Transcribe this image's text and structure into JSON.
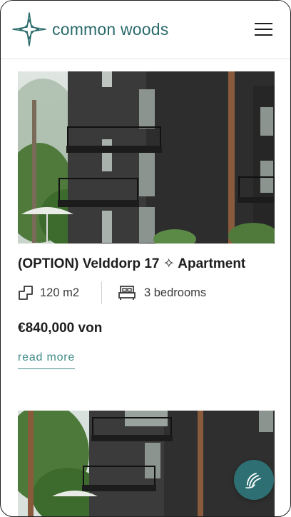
{
  "brand": {
    "name": "common woods"
  },
  "header": {
    "menu_icon": "hamburger-menu-icon"
  },
  "listings": [
    {
      "title": "(OPTION) Velddorp 17 ✧ Apartment",
      "area": "120 m2",
      "bedrooms": "3 bedrooms",
      "price": "€840,000 von",
      "read_more": "read more"
    }
  ],
  "icons": {
    "area": "floor-area-icon",
    "bed": "bed-icon",
    "fab": "chat-wave-icon"
  },
  "colors": {
    "accent": "#2b6a6b",
    "link": "#3f8a87",
    "fab": "#2d6f72"
  }
}
